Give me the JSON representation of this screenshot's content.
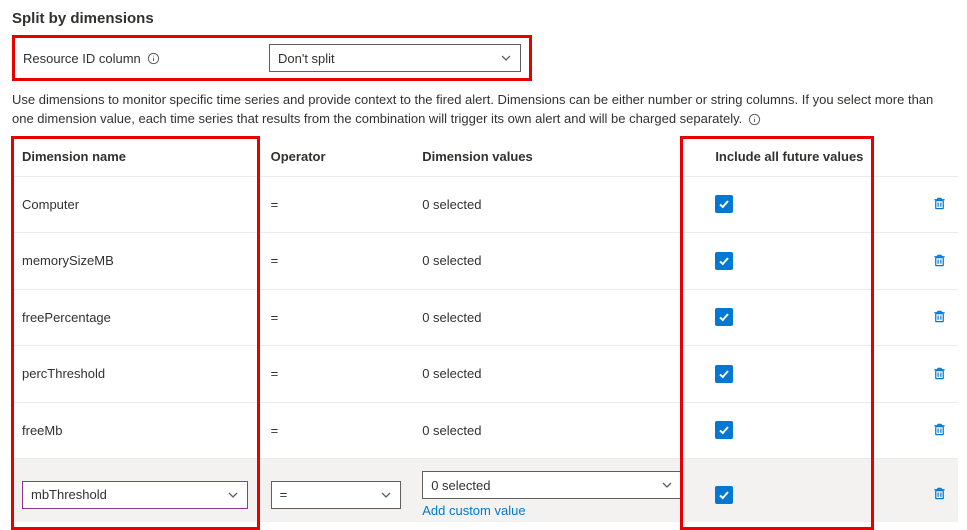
{
  "section": {
    "title": "Split by dimensions"
  },
  "resource_id": {
    "label": "Resource ID column",
    "selected": "Don't split"
  },
  "help": {
    "text": "Use dimensions to monitor specific time series and provide context to the fired alert. Dimensions can be either number or string columns. If you select more than one dimension value, each time series that results from the combination will trigger its own alert and will be charged separately."
  },
  "table": {
    "headers": {
      "name": "Dimension name",
      "operator": "Operator",
      "values": "Dimension values",
      "include": "Include all future values"
    },
    "rows": [
      {
        "name": "Computer",
        "operator": "=",
        "values": "0 selected",
        "include": true
      },
      {
        "name": "memorySizeMB",
        "operator": "=",
        "values": "0 selected",
        "include": true
      },
      {
        "name": "freePercentage",
        "operator": "=",
        "values": "0 selected",
        "include": true
      },
      {
        "name": "percThreshold",
        "operator": "=",
        "values": "0 selected",
        "include": true
      },
      {
        "name": "freeMb",
        "operator": "=",
        "values": "0 selected",
        "include": true
      }
    ],
    "edit_row": {
      "name": "mbThreshold",
      "operator": "=",
      "values": "0 selected",
      "include": true,
      "custom_link": "Add custom value"
    }
  }
}
